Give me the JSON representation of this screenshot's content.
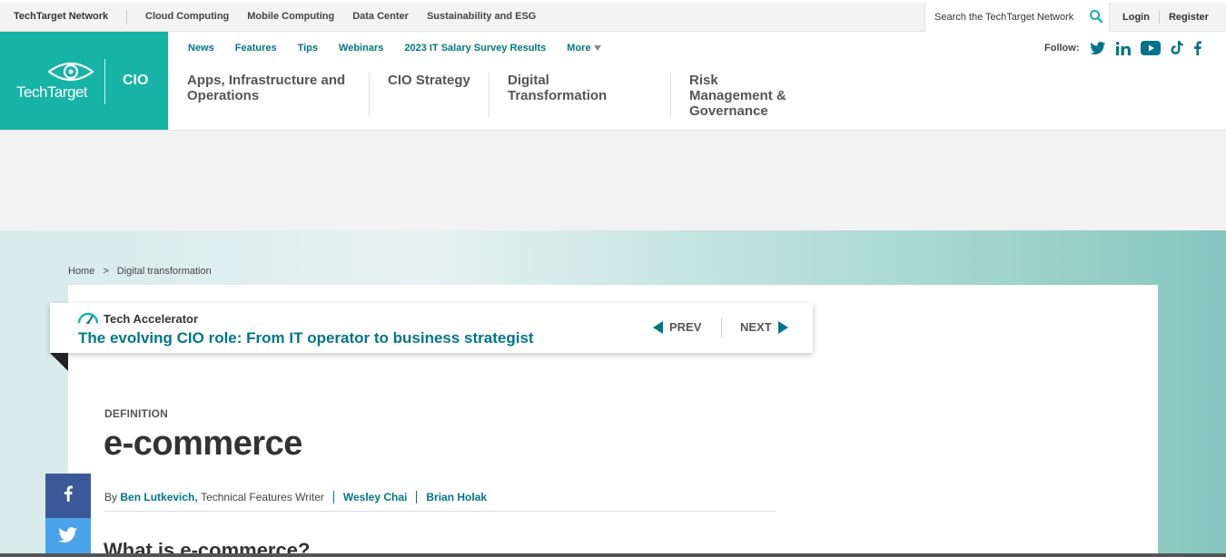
{
  "network_bar": {
    "brand": "TechTarget Network",
    "links": [
      "Cloud Computing",
      "Mobile Computing",
      "Data Center",
      "Sustainability and ESG"
    ],
    "search_placeholder": "Search the TechTarget Network",
    "login": "Login",
    "register": "Register"
  },
  "logo": {
    "wordmark": "TechTarget",
    "site": "CIO"
  },
  "subnav": {
    "items": [
      "News",
      "Features",
      "Tips",
      "Webinars",
      "2023 IT Salary Survey Results"
    ],
    "more": "More"
  },
  "follow": {
    "label": "Follow:",
    "icons": [
      "twitter-icon",
      "linkedin-icon",
      "youtube-icon",
      "tiktok-icon",
      "facebook-icon"
    ]
  },
  "topics": [
    "Apps, Infrastructure and Operations",
    "CIO Strategy",
    "Digital Transformation",
    "Risk Management & Governance"
  ],
  "breadcrumb": {
    "home": "Home",
    "separator": ">",
    "section": "Digital transformation"
  },
  "accelerator": {
    "kicker": "Tech Accelerator",
    "title": "The evolving CIO role: From IT operator to business strategist",
    "prev": "PREV",
    "next": "NEXT"
  },
  "article": {
    "label": "DEFINITION",
    "title": "e-commerce",
    "by": "By",
    "author1": "Ben Lutkevich,",
    "author1_role": "Technical Features Writer",
    "author2": "Wesley Chai",
    "author3": "Brian Holak",
    "subhead": "What is e-commerce?"
  },
  "colors": {
    "brand_teal": "#16b3a6",
    "link_teal": "#00758a",
    "facebook": "#3b5998",
    "twitter": "#4aa3ea"
  }
}
